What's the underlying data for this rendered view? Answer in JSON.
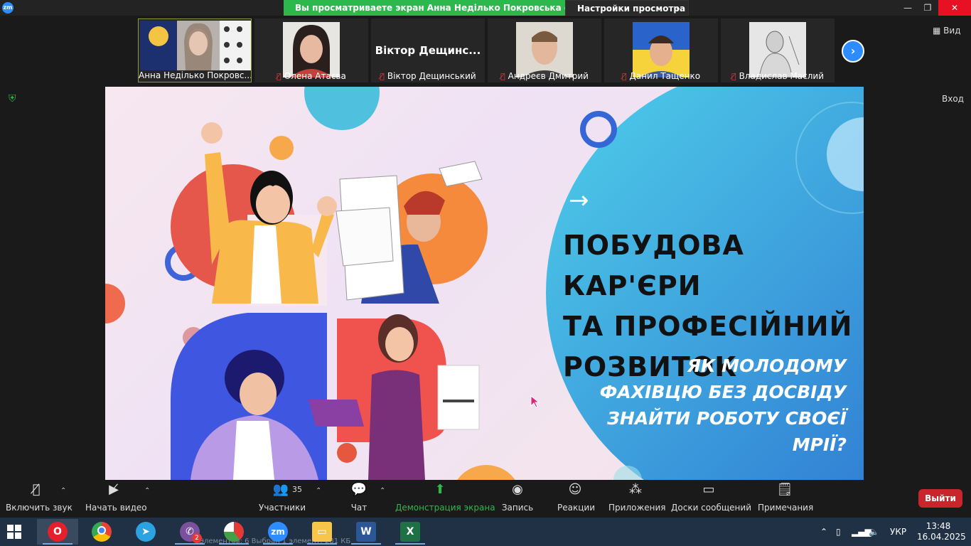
{
  "window": {
    "app_logo_text": "zm",
    "share_banner": "Вы просматриваете экран Анна Неділько Покровська філія...",
    "view_settings": "Настройки просмотра",
    "minimize": "—",
    "maximize": "❐",
    "close": "✕"
  },
  "gallery": {
    "participants": [
      {
        "name": "Анна Неділько Покровс...",
        "muted": false,
        "active": true
      },
      {
        "name": "Олена Атаєва",
        "muted": true
      },
      {
        "name": "Віктор Дещинський",
        "muted": true,
        "video_placeholder": "Віктор Дещинс..."
      },
      {
        "name": "Андреєв Дмитрий",
        "muted": true
      },
      {
        "name": "Данил Тащенко",
        "muted": true
      },
      {
        "name": "Владислав Маслий",
        "muted": true
      }
    ],
    "next_label": "›",
    "view_label": "Вид",
    "exit_fullscreen": "Вход"
  },
  "slide": {
    "title_lines": [
      "ПОБУДОВА  КАР'ЄРИ",
      "ТА ПРОФЕСІЙНИЙ",
      "РОЗВИТОК"
    ],
    "subtitle_lines": [
      "ЯК МОЛОДОМУ",
      "ФАХІВЦЮ БЕЗ ДОСВІДУ",
      "ЗНАЙТИ РОБОТУ СВОЄЇ",
      "МРІЇ?"
    ],
    "arrow": "→"
  },
  "toolbar": {
    "audio": "Включить звук",
    "video": "Начать видео",
    "participants": "Участники",
    "participants_count": "35",
    "chat": "Чат",
    "share": "Демонстрация экрана",
    "record": "Запись",
    "reactions": "Реакции",
    "apps": "Приложения",
    "whiteboards": "Доски сообщений",
    "notes": "Примечания",
    "leave": "Выйти"
  },
  "taskbar": {
    "viber_badge": "2",
    "background_status": "Элементов: 6     Выбран 1 элемент: 281 КБ",
    "language": "УКР",
    "time": "13:48",
    "date": "16.04.2025"
  },
  "colors": {
    "zoom_blue": "#2d8cff",
    "share_green": "#2db84d",
    "leave_red": "#c8252c",
    "slide_blue_start": "#4fc3e8",
    "slide_blue_end": "#2b6fcf"
  }
}
